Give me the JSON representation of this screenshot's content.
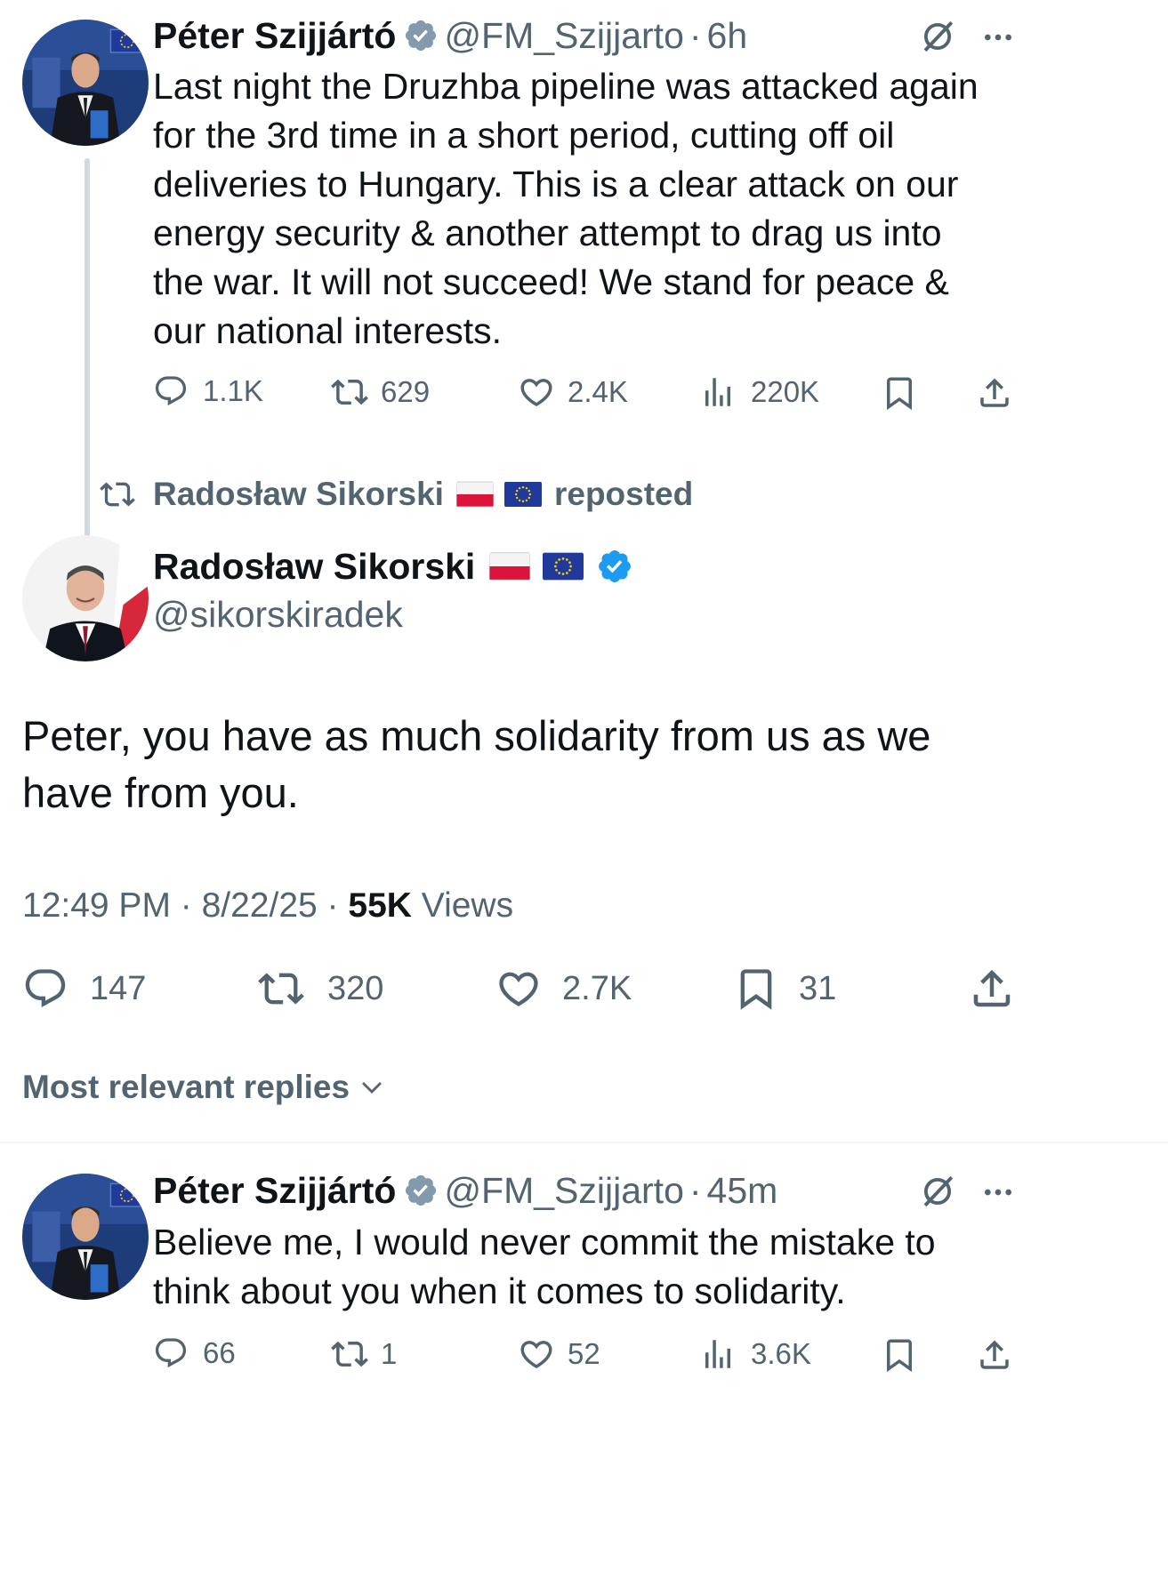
{
  "thread_tweet": {
    "author_name": "Péter Szijjártó",
    "handle": "@FM_Szijjarto",
    "time": "6h",
    "text_lines": [
      "Last night the Druzhba pipeline was attacked again",
      "for the 3rd time in a short period, cutting off oil",
      "deliveries to Hungary. This is a clear attack on our",
      "energy security & another attempt to drag us into",
      "the war. It will not succeed! We stand for peace &",
      "our national interests."
    ],
    "replies": "1.1K",
    "reposts": "629",
    "likes": "2.4K",
    "views": "220K"
  },
  "repost_banner": {
    "name": "Radosław Sikorski",
    "label": "reposted"
  },
  "main_tweet": {
    "author_name": "Radosław Sikorski",
    "handle": "@sikorskiradek",
    "text_lines": [
      "Peter, you have as much solidarity from us as we",
      "have from you."
    ],
    "timestamp": "12:49 PM · 8/22/25 · ",
    "views_count": "55K",
    "views_label": " Views",
    "replies": "147",
    "reposts": "320",
    "likes": "2.7K",
    "bookmarks": "31"
  },
  "replies_filter": {
    "label": "Most relevant replies"
  },
  "reply_tweet": {
    "author_name": "Péter Szijjártó",
    "handle": "@FM_Szijjarto",
    "time": "45m",
    "text_lines": [
      "Believe me, I would never commit the mistake to",
      "think about you when it comes to solidarity."
    ],
    "replies": "66",
    "reposts": "1",
    "likes": "52",
    "views": "3.6K"
  },
  "colors": {
    "text": "#0f1419",
    "muted": "#536471",
    "verified_gray": "#829aab",
    "verified_blue": "#1d9bf0",
    "divider": "#eff3f4"
  },
  "icons": [
    "reply-icon",
    "repost-icon",
    "like-icon",
    "views-icon",
    "bookmark-icon",
    "share-icon",
    "grok-icon",
    "more-icon",
    "verified-badge",
    "chevron-down-icon"
  ]
}
